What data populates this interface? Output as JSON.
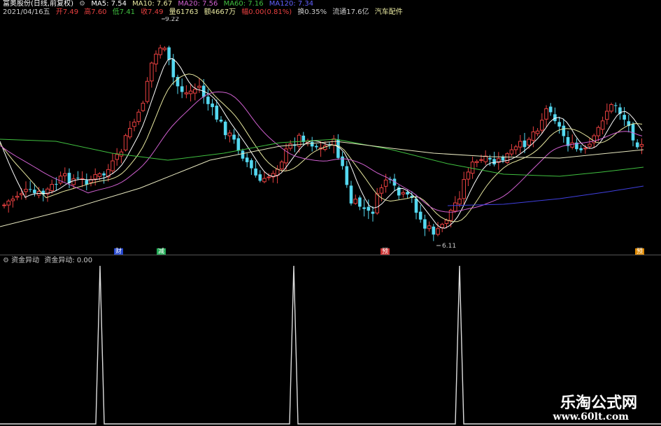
{
  "header": {
    "title": "富奥股份(日线,前复权)",
    "ma5": "MA5: 7.54",
    "ma10": "MA10: 7.67",
    "ma20": "MA20: 7.56",
    "ma60": "MA60: 7.16",
    "ma120": "MA120: 7.34",
    "date": "2021/04/16五",
    "open": "开7.49",
    "high": "高7.60",
    "low": "低7.41",
    "close": "收7.49",
    "volume": "量61763",
    "amount": "额4667万",
    "change": "幅0.00(0.81%)",
    "turnover": "换0.35%",
    "float_cap": "流通17.6亿",
    "sector": "汽车配件"
  },
  "price_labels": {
    "high": "9.22",
    "low": "6.11"
  },
  "markers": [
    {
      "label": "财",
      "color": "#4466ff"
    },
    {
      "label": "减",
      "color": "#22aa55"
    },
    {
      "label": "预",
      "color": "#ff4444"
    },
    {
      "label": "预",
      "color": "#ffaa00"
    }
  ],
  "indicator": {
    "title": "资金异动",
    "value_label": "资金异动: 0.00",
    "spikes": 3
  },
  "colors": {
    "up": "#e84040",
    "down": "#54d8f0",
    "ma5": "#ffffff",
    "ma10": "#e8e8a0",
    "ma20": "#d060d0",
    "ma60": "#40c040",
    "ma120": "#4040e0"
  },
  "watermark": {
    "line1": "乐淘公式网",
    "line2": "www.60lt.com"
  }
}
